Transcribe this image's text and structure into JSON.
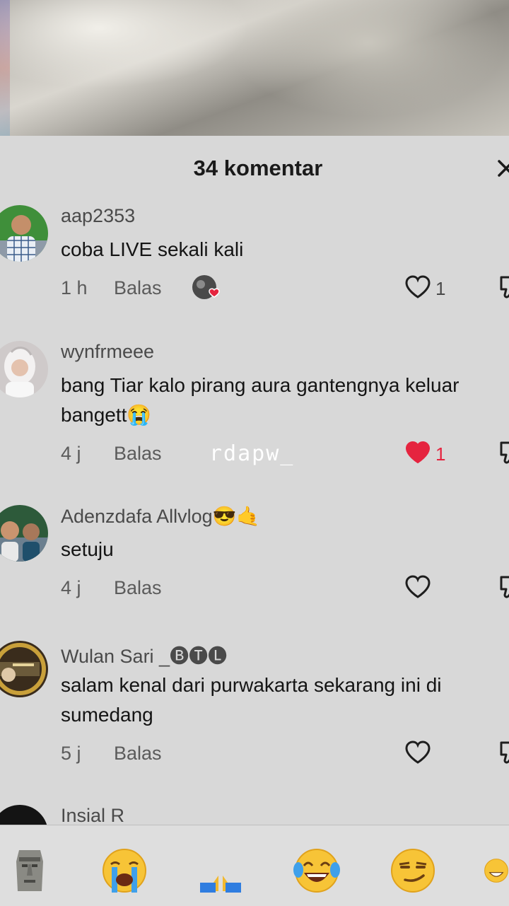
{
  "header": {
    "title": "34 komentar",
    "close_icon": "close-icon"
  },
  "watermark": "rdapw_",
  "comments": [
    {
      "username": "aap2353",
      "text": "coba LIVE sekali kali",
      "time": "1 h",
      "reply": "Balas",
      "likes": "1",
      "liked": false,
      "creator_liked": true
    },
    {
      "username": "wynfrmeee",
      "text": "bang Tiar kalo pirang aura gantengnya keluar bangett😭",
      "time": "4 j",
      "reply": "Balas",
      "likes": "1",
      "liked": true
    },
    {
      "username": "Adenzdafa  Allvlog😎🤙",
      "text": "setuju",
      "time": "4 j",
      "reply": "Balas",
      "likes": "",
      "liked": false
    },
    {
      "username": "Wulan Sari _🅑🅣🅛",
      "text": "salam kenal dari purwakarta sekarang ini di sumedang",
      "time": "5 j",
      "reply": "Balas",
      "likes": "",
      "liked": false
    },
    {
      "username": "Insial R",
      "text": "",
      "time": "",
      "reply": "",
      "likes": ""
    }
  ],
  "quick_emojis": [
    "🗿",
    "😭",
    "🙏",
    "😂",
    "😏",
    "😁"
  ],
  "colors": {
    "like_red": "#e5243f",
    "sheet_bg": "#d8d8d8"
  }
}
